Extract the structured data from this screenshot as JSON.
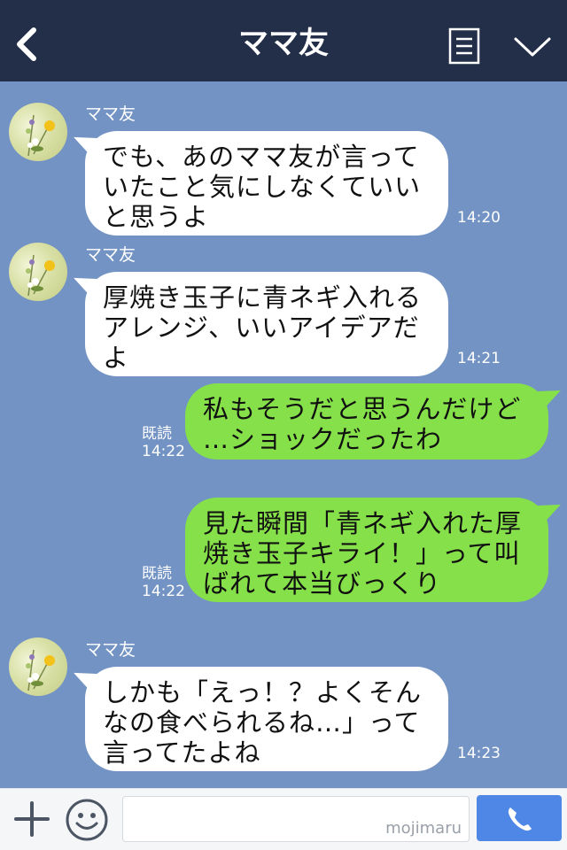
{
  "header": {
    "title": "ママ友",
    "back_icon": "chevron-left-icon",
    "menu_icon": "menu-list-icon",
    "down_icon": "chevron-down-icon",
    "background": "#232f48"
  },
  "chat": {
    "background": "#7293c3",
    "messages": [
      {
        "side": "left",
        "sender": "ママ友",
        "lines": [
          "でも、あのママ友が言って",
          "いたこと気にしなくていい",
          "と思うよ"
        ],
        "time": "14:20"
      },
      {
        "side": "left",
        "sender": "ママ友",
        "lines": [
          "厚焼き玉子に青ネギ入れる",
          "アレンジ、いいアイデアだ",
          "よ"
        ],
        "time": "14:21"
      },
      {
        "side": "right",
        "read": "既読",
        "lines": [
          "私もそうだと思うんだけど",
          "…ショックだったわ"
        ],
        "time": "14:22"
      },
      {
        "side": "right",
        "read": "既読",
        "lines": [
          "見た瞬間「青ネギ入れた厚",
          "焼き玉子キライ！」って叫",
          "ばれて本当びっくり"
        ],
        "time": "14:22"
      },
      {
        "side": "left",
        "sender": "ママ友",
        "lines": [
          "しかも「えっ！？よくそん",
          "なの食べられるね…」って",
          "言ってたよね"
        ],
        "time": "14:23"
      }
    ]
  },
  "footer": {
    "plus_icon": "plus-icon",
    "emoji_icon": "smiley-icon",
    "input_placeholder": "",
    "watermark": "mojimaru",
    "call_icon": "phone-icon",
    "call_color": "#4e87e6"
  }
}
